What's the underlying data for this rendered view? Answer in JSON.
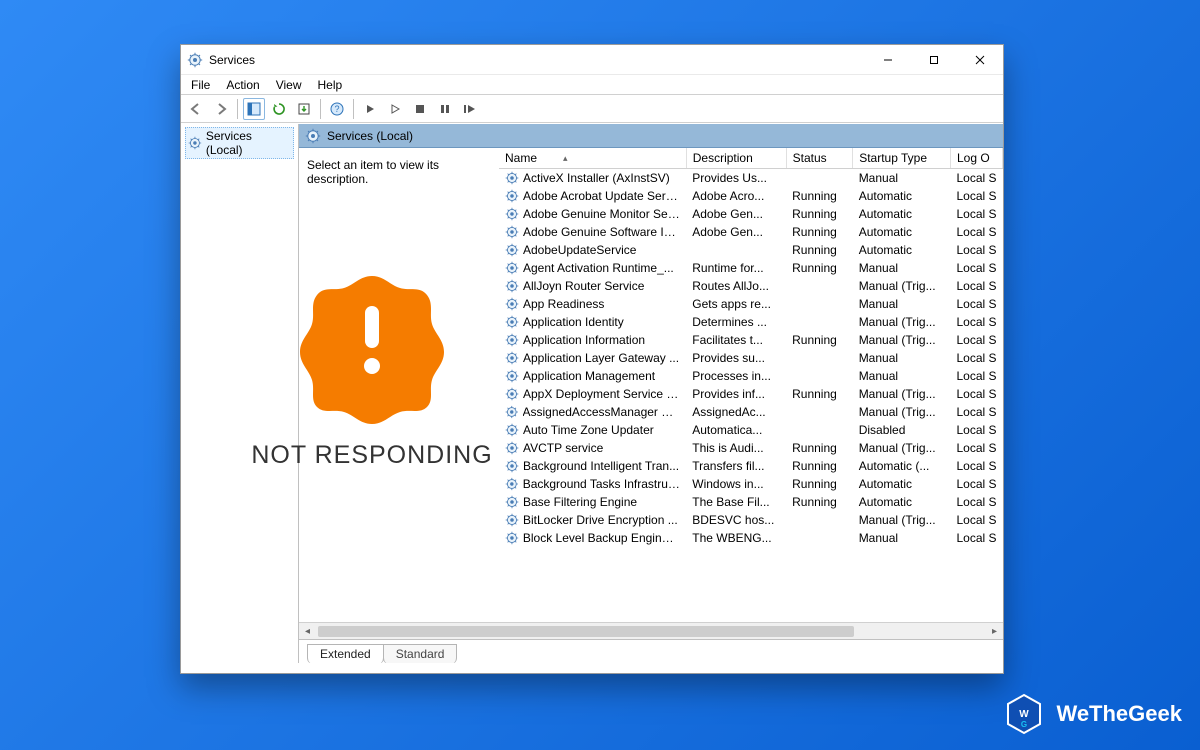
{
  "window": {
    "title": "Services"
  },
  "menu": {
    "file": "File",
    "action": "Action",
    "view": "View",
    "help": "Help"
  },
  "tree": {
    "root": "Services (Local)"
  },
  "pane": {
    "header": "Services (Local)",
    "hint": "Select an item to view its description."
  },
  "columns": {
    "name": "Name",
    "desc": "Description",
    "status": "Status",
    "startup": "Startup Type",
    "logon": "Log O"
  },
  "tabs": {
    "extended": "Extended",
    "standard": "Standard"
  },
  "overlay": {
    "text": "NOT RESPONDING"
  },
  "watermark": {
    "text": "WeTheGeek"
  },
  "services": [
    {
      "name": "ActiveX Installer (AxInstSV)",
      "desc": "Provides Us...",
      "status": "",
      "startup": "Manual",
      "logon": "Local S"
    },
    {
      "name": "Adobe Acrobat Update Serv...",
      "desc": "Adobe Acro...",
      "status": "Running",
      "startup": "Automatic",
      "logon": "Local S"
    },
    {
      "name": "Adobe Genuine Monitor Ser...",
      "desc": "Adobe Gen...",
      "status": "Running",
      "startup": "Automatic",
      "logon": "Local S"
    },
    {
      "name": "Adobe Genuine Software In...",
      "desc": "Adobe Gen...",
      "status": "Running",
      "startup": "Automatic",
      "logon": "Local S"
    },
    {
      "name": "AdobeUpdateService",
      "desc": "",
      "status": "Running",
      "startup": "Automatic",
      "logon": "Local S"
    },
    {
      "name": "Agent Activation Runtime_...",
      "desc": "Runtime for...",
      "status": "Running",
      "startup": "Manual",
      "logon": "Local S"
    },
    {
      "name": "AllJoyn Router Service",
      "desc": "Routes AllJo...",
      "status": "",
      "startup": "Manual (Trig...",
      "logon": "Local S"
    },
    {
      "name": "App Readiness",
      "desc": "Gets apps re...",
      "status": "",
      "startup": "Manual",
      "logon": "Local S"
    },
    {
      "name": "Application Identity",
      "desc": "Determines ...",
      "status": "",
      "startup": "Manual (Trig...",
      "logon": "Local S"
    },
    {
      "name": "Application Information",
      "desc": "Facilitates t...",
      "status": "Running",
      "startup": "Manual (Trig...",
      "logon": "Local S"
    },
    {
      "name": "Application Layer Gateway ...",
      "desc": "Provides su...",
      "status": "",
      "startup": "Manual",
      "logon": "Local S"
    },
    {
      "name": "Application Management",
      "desc": "Processes in...",
      "status": "",
      "startup": "Manual",
      "logon": "Local S"
    },
    {
      "name": "AppX Deployment Service (...",
      "desc": "Provides inf...",
      "status": "Running",
      "startup": "Manual (Trig...",
      "logon": "Local S"
    },
    {
      "name": "AssignedAccessManager Se...",
      "desc": "AssignedAc...",
      "status": "",
      "startup": "Manual (Trig...",
      "logon": "Local S"
    },
    {
      "name": "Auto Time Zone Updater",
      "desc": "Automatica...",
      "status": "",
      "startup": "Disabled",
      "logon": "Local S"
    },
    {
      "name": "AVCTP service",
      "desc": "This is Audi...",
      "status": "Running",
      "startup": "Manual (Trig...",
      "logon": "Local S"
    },
    {
      "name": "Background Intelligent Tran...",
      "desc": "Transfers fil...",
      "status": "Running",
      "startup": "Automatic (...",
      "logon": "Local S"
    },
    {
      "name": "Background Tasks Infrastruc...",
      "desc": "Windows in...",
      "status": "Running",
      "startup": "Automatic",
      "logon": "Local S"
    },
    {
      "name": "Base Filtering Engine",
      "desc": "The Base Fil...",
      "status": "Running",
      "startup": "Automatic",
      "logon": "Local S"
    },
    {
      "name": "BitLocker Drive Encryption ...",
      "desc": "BDESVC hos...",
      "status": "",
      "startup": "Manual (Trig...",
      "logon": "Local S"
    },
    {
      "name": "Block Level Backup Engine ...",
      "desc": "The WBENG...",
      "status": "",
      "startup": "Manual",
      "logon": "Local S"
    }
  ]
}
